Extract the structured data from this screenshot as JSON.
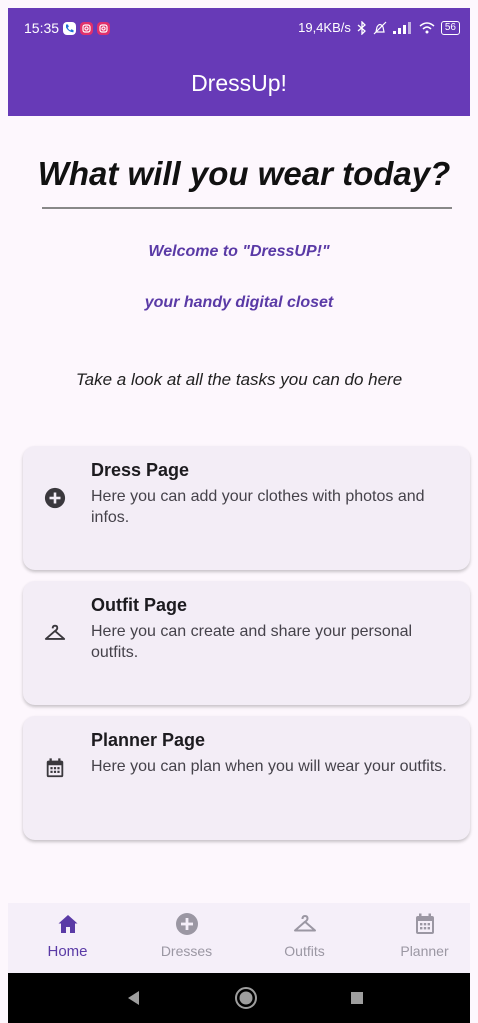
{
  "status": {
    "time": "15:35",
    "net_speed": "19,4KB/s",
    "battery": "56"
  },
  "app_bar": {
    "title": "DressUp!"
  },
  "home": {
    "headline": "What will you wear today?",
    "welcome": "Welcome to \"DressUP!\"",
    "tagline": "your handy digital closet",
    "intro": "Take a look at all the tasks you can do here"
  },
  "cards": [
    {
      "icon": "add-circle-icon",
      "title": "Dress Page",
      "description": "Here you can add your clothes with photos and infos."
    },
    {
      "icon": "hanger-icon",
      "title": "Outfit Page",
      "description": "Here you can create and share your personal outfits."
    },
    {
      "icon": "calendar-icon",
      "title": "Planner Page",
      "description": "Here you can plan when you will wear your outfits."
    }
  ],
  "nav": [
    {
      "label": "Home",
      "icon": "home-icon",
      "active": true
    },
    {
      "label": "Dresses",
      "icon": "add-circle-icon",
      "active": false
    },
    {
      "label": "Outfits",
      "icon": "hanger-icon",
      "active": false
    },
    {
      "label": "Planner",
      "icon": "calendar-icon",
      "active": false
    }
  ],
  "colors": {
    "primary": "#673ab7",
    "accent_text": "#5a3aa6",
    "card_bg": "#f3edf6",
    "background": "#fdf7fd"
  }
}
